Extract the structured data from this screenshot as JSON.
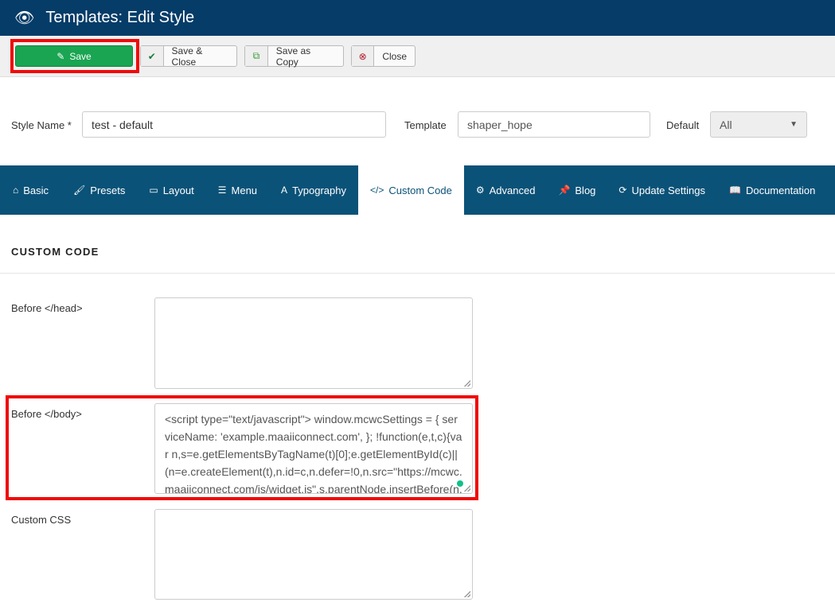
{
  "header": {
    "title": "Templates: Edit Style",
    "icon": "eye-icon"
  },
  "toolbar": {
    "save": "Save",
    "save_close": "Save & Close",
    "save_copy": "Save as Copy",
    "close": "Close"
  },
  "form": {
    "style_name_label": "Style Name *",
    "style_name_value": "test - default",
    "template_label": "Template",
    "template_value": "shaper_hope",
    "default_label": "Default",
    "default_value": "All"
  },
  "tabs": [
    {
      "label": "Basic",
      "icon": "⌂"
    },
    {
      "label": "Presets",
      "icon": "🖌"
    },
    {
      "label": "Layout",
      "icon": "▭"
    },
    {
      "label": "Menu",
      "icon": "☰"
    },
    {
      "label": "Typography",
      "icon": "A"
    },
    {
      "label": "Custom Code",
      "icon": "</>"
    },
    {
      "label": "Advanced",
      "icon": "⚙"
    },
    {
      "label": "Blog",
      "icon": "📌"
    },
    {
      "label": "Update Settings",
      "icon": "⟳"
    },
    {
      "label": "Documentation",
      "icon": "📖"
    }
  ],
  "section": {
    "title": "CUSTOM CODE",
    "before_head_label": "Before </head>",
    "before_head_value": "",
    "before_body_label": "Before </body>",
    "before_body_value": "<script type=\"text/javascript\"> window.mcwcSettings = { serviceName: 'example.maaiiconnect.com', }; !function(e,t,c){var n,s=e.getElementsByTagName(t)[0];e.getElementById(c)||(n=e.createElement(t),n.id=c,n.defer=!0,n.src=\"https://mcwc.maaiiconnect.com/js/widget.js\",s.parentNode.insertBefore(n,s))}(document,\"script\",\"mcwc-jssdk\");",
    "custom_css_label": "Custom CSS",
    "custom_css_value": ""
  },
  "colors": {
    "header": "#053c68",
    "tabs": "#0b5278",
    "save": "#1aa552",
    "highlight": "#f00a0a"
  }
}
